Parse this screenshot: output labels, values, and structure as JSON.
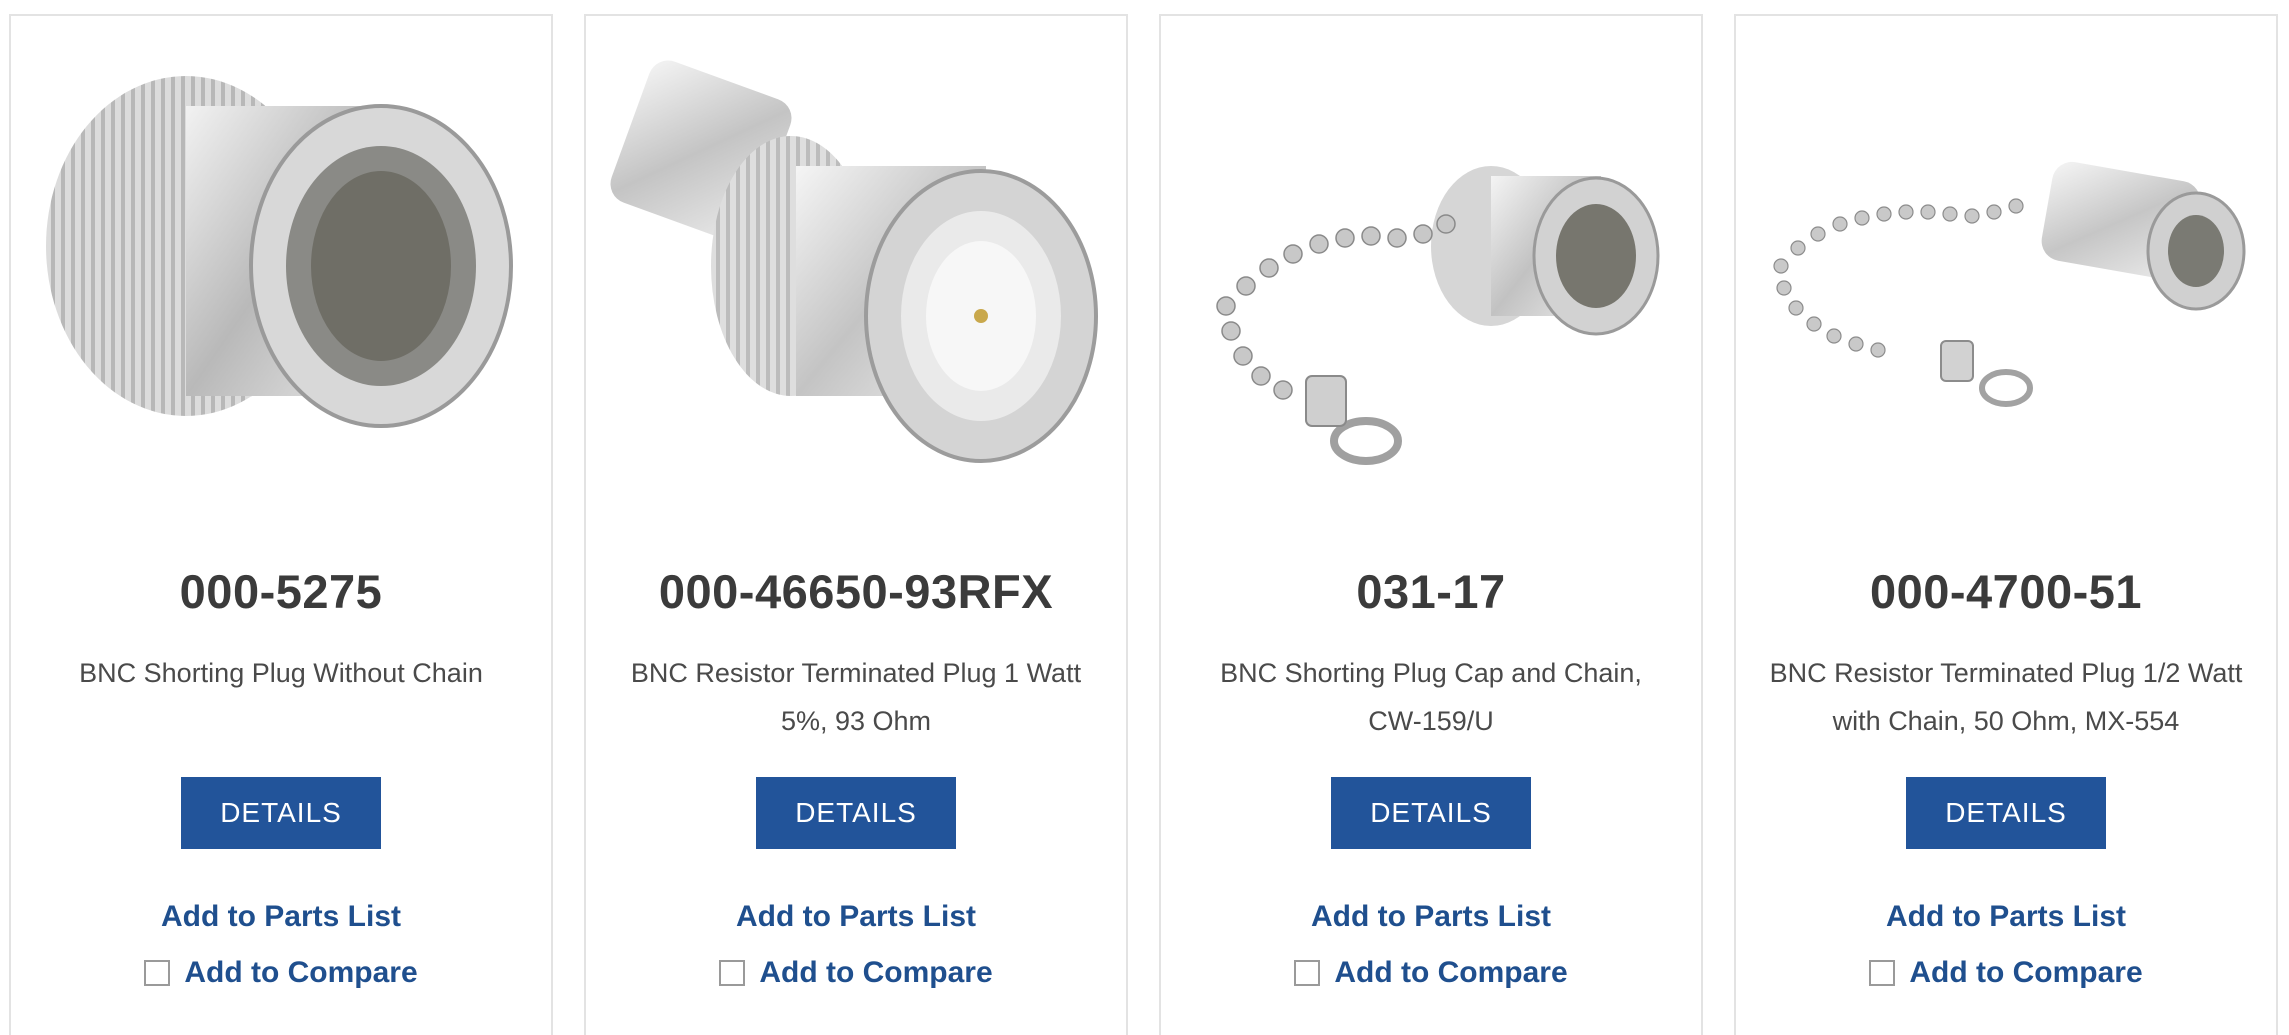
{
  "products": [
    {
      "part_number": "000-5275",
      "description": "BNC Shorting Plug Without Chain",
      "image_icon": "bnc-shorting-plug-image",
      "details_label": "DETAILS",
      "parts_list_label": "Add to Parts List",
      "compare_label": "Add to Compare"
    },
    {
      "part_number": "000-46650-93RFX",
      "description": "BNC Resistor Terminated Plug 1 Watt 5%, 93 Ohm",
      "image_icon": "bnc-resistor-plug-image",
      "details_label": "DETAILS",
      "parts_list_label": "Add to Parts List",
      "compare_label": "Add to Compare"
    },
    {
      "part_number": "031-17",
      "description": "BNC Shorting Plug Cap and Chain, CW-159/U",
      "image_icon": "bnc-cap-chain-image",
      "details_label": "DETAILS",
      "parts_list_label": "Add to Parts List",
      "compare_label": "Add to Compare"
    },
    {
      "part_number": "000-4700-51",
      "description": "BNC Resistor Terminated Plug 1/2 Watt with Chain, 50 Ohm, MX-554",
      "image_icon": "bnc-resistor-chain-image",
      "details_label": "DETAILS",
      "parts_list_label": "Add to Parts List",
      "compare_label": "Add to Compare"
    }
  ],
  "colors": {
    "button": "#22549a",
    "link": "#1f4f8e",
    "part_number": "#3b3b3b",
    "card_border": "#e3e3e3"
  }
}
